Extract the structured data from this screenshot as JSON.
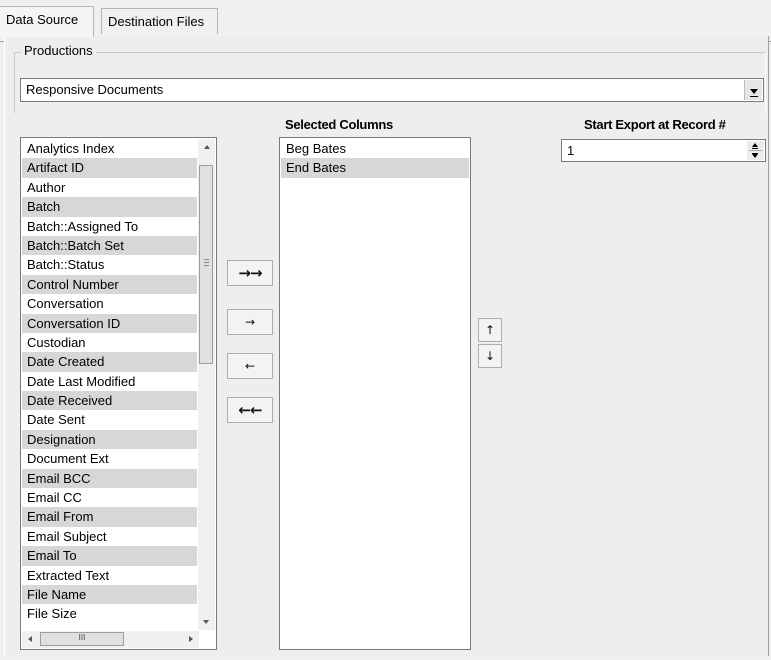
{
  "tabs": [
    {
      "label": "Data Source",
      "active": true
    },
    {
      "label": "Destination Files",
      "active": false
    }
  ],
  "productions": {
    "group_label": "Productions",
    "selected_value": "Responsive Documents"
  },
  "available_fields": {
    "items": [
      "Analytics Index",
      "Artifact ID",
      "Author",
      "Batch",
      "Batch::Assigned To",
      "Batch::Batch Set",
      "Batch::Status",
      "Control Number",
      "Conversation",
      "Conversation ID",
      "Custodian",
      "Date Created",
      "Date Last Modified",
      "Date Received",
      "Date Sent",
      "Designation",
      "Document Ext",
      "Email BCC",
      "Email CC",
      "Email From",
      "Email Subject",
      "Email To",
      "Extracted Text",
      "File Name",
      "File Size"
    ],
    "hscroll_grip": "III"
  },
  "transfer_buttons": {
    "add_all": "→→",
    "add": "→",
    "remove": "←",
    "remove_all": "←←"
  },
  "selected_columns": {
    "header": "Selected Columns",
    "items": [
      "Beg Bates",
      "End Bates"
    ]
  },
  "order_buttons": {
    "move_up": "↑",
    "move_down": "↓"
  },
  "start_export": {
    "label": "Start Export at Record #",
    "value": "1"
  },
  "colors": {
    "window_bg": "#eeeeee",
    "row_shade": "#d7d7d7",
    "border": "#7a7a7a"
  }
}
